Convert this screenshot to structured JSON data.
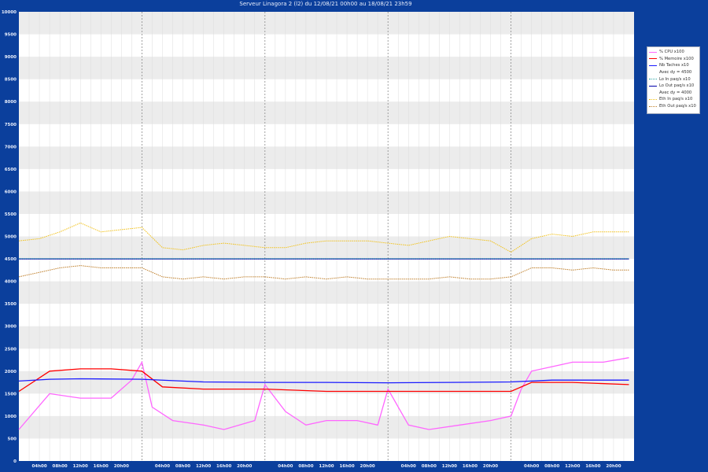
{
  "chart_title": "Serveur Linagora 2 (l2) du 12/08/21 00h00 au 18/08/21 23h59",
  "chart_data": {
    "type": "line",
    "title": "Serveur Linagora 2 (l2) du 12/08/21 00h00 au 18/08/21 23h59",
    "xlabel": "",
    "ylabel": "",
    "ylim": [
      0,
      10000
    ],
    "y_ticks": [
      {
        "value": 0,
        "label": "0"
      },
      {
        "value": 500,
        "label": "500"
      },
      {
        "value": 1000,
        "label": "1000"
      },
      {
        "value": 1500,
        "label": "1500"
      },
      {
        "value": 2000,
        "label": "2000"
      },
      {
        "value": 2500,
        "label": "2500"
      },
      {
        "value": 3000,
        "label": "3000"
      },
      {
        "value": 3500,
        "label": "3500"
      },
      {
        "value": 4000,
        "label": "4000"
      },
      {
        "value": 4500,
        "label": "4500"
      },
      {
        "value": 5000,
        "label": "5000"
      },
      {
        "value": 5500,
        "label": "5500"
      },
      {
        "value": 6000,
        "label": "6000"
      },
      {
        "value": 6500,
        "label": "6500"
      },
      {
        "value": 7000,
        "label": "7000"
      },
      {
        "value": 7500,
        "label": "7500"
      },
      {
        "value": 8000,
        "label": "8000"
      },
      {
        "value": 8500,
        "label": "8500"
      },
      {
        "value": 9000,
        "label": "9000"
      },
      {
        "value": 9500,
        "label": "9500"
      },
      {
        "value": 10000,
        "label": "10000"
      }
    ],
    "x_ticks": [
      {
        "value": 4,
        "label": "04h00"
      },
      {
        "value": 8,
        "label": "08h00"
      },
      {
        "value": 12,
        "label": "12h00"
      },
      {
        "value": 16,
        "label": "16h00"
      },
      {
        "value": 20,
        "label": "20h00"
      },
      {
        "value": 28,
        "label": "04h00"
      },
      {
        "value": 32,
        "label": "08h00"
      },
      {
        "value": 36,
        "label": "12h00"
      },
      {
        "value": 40,
        "label": "16h00"
      },
      {
        "value": 44,
        "label": "20h00"
      },
      {
        "value": 52,
        "label": "04h00"
      },
      {
        "value": 56,
        "label": "08h00"
      },
      {
        "value": 60,
        "label": "12h00"
      },
      {
        "value": 64,
        "label": "16h00"
      },
      {
        "value": 68,
        "label": "20h00"
      },
      {
        "value": 76,
        "label": "04h00"
      },
      {
        "value": 80,
        "label": "08h00"
      },
      {
        "value": 84,
        "label": "12h00"
      },
      {
        "value": 88,
        "label": "16h00"
      },
      {
        "value": 92,
        "label": "20h00"
      },
      {
        "value": 100,
        "label": "04h00"
      },
      {
        "value": 104,
        "label": "08h00"
      },
      {
        "value": 108,
        "label": "12h00"
      },
      {
        "value": 112,
        "label": "16h00"
      },
      {
        "value": 116,
        "label": "20h00"
      }
    ],
    "xlim": [
      0,
      120
    ],
    "grid": true,
    "legend_position": "right",
    "series": [
      {
        "name": "% CPU x100",
        "color": "#ff66ff",
        "style": "solid",
        "x": [
          0,
          6,
          12,
          18,
          22,
          24,
          26,
          30,
          36,
          40,
          46,
          48,
          52,
          56,
          60,
          66,
          70,
          72,
          76,
          80,
          86,
          92,
          96,
          98,
          100,
          104,
          108,
          114,
          119
        ],
        "y": [
          700,
          1500,
          1400,
          1400,
          1800,
          2200,
          1200,
          900,
          800,
          700,
          900,
          1700,
          1100,
          800,
          900,
          900,
          800,
          1600,
          800,
          700,
          800,
          900,
          1000,
          1600,
          2000,
          2100,
          2200,
          2200,
          2300
        ]
      },
      {
        "name": "% Memoire x100",
        "color": "#ff0000",
        "style": "solid",
        "x": [
          0,
          6,
          12,
          18,
          24,
          28,
          36,
          48,
          60,
          72,
          84,
          96,
          100,
          108,
          119
        ],
        "y": [
          1550,
          2000,
          2050,
          2050,
          2000,
          1650,
          1600,
          1600,
          1550,
          1550,
          1550,
          1550,
          1750,
          1750,
          1700
        ]
      },
      {
        "name": "Nb Taches x10",
        "color": "#1a1aff",
        "style": "solid",
        "x": [
          0,
          6,
          12,
          24,
          36,
          48,
          60,
          72,
          84,
          96,
          104,
          119
        ],
        "y": [
          1780,
          1820,
          1830,
          1820,
          1760,
          1750,
          1750,
          1740,
          1750,
          1760,
          1800,
          1800
        ]
      },
      {
        "name": "Avec dy = 4500",
        "color": "#00aa00",
        "style": "none",
        "x": [
          0,
          119
        ],
        "y": [
          4500,
          4500
        ]
      },
      {
        "name": "Lo  In  paq/s x10",
        "color": "#2ea6a6",
        "style": "dot",
        "x": [
          0,
          119
        ],
        "y": [
          4505,
          4505
        ]
      },
      {
        "name": "Lo  Out paq/s x10",
        "color": "#0000aa",
        "style": "solid",
        "x": [
          0,
          119
        ],
        "y": [
          4500,
          4500
        ]
      },
      {
        "name": "Avec dy = 4000",
        "color": "#00aa00",
        "style": "none",
        "x": [
          0,
          119
        ],
        "y": [
          4000,
          4000
        ]
      },
      {
        "name": "Eth  In  paq/s x10",
        "color": "#f2c21b",
        "style": "dot",
        "x": [
          0,
          4,
          8,
          12,
          16,
          20,
          24,
          28,
          32,
          36,
          40,
          44,
          48,
          52,
          56,
          60,
          64,
          68,
          72,
          76,
          80,
          84,
          88,
          92,
          96,
          100,
          104,
          108,
          112,
          116,
          119
        ],
        "y": [
          4900,
          4950,
          5100,
          5300,
          5100,
          5150,
          5200,
          4750,
          4700,
          4800,
          4850,
          4800,
          4750,
          4750,
          4850,
          4900,
          4900,
          4900,
          4850,
          4800,
          4900,
          5000,
          4950,
          4900,
          4650,
          4950,
          5050,
          5000,
          5100,
          5100,
          5100
        ]
      },
      {
        "name": "Eth  Out paq/s x10",
        "color": "#bf7f2a",
        "style": "dot",
        "x": [
          0,
          4,
          8,
          12,
          16,
          20,
          24,
          28,
          32,
          36,
          40,
          44,
          48,
          52,
          56,
          60,
          64,
          68,
          72,
          76,
          80,
          84,
          88,
          92,
          96,
          100,
          104,
          108,
          112,
          116,
          119
        ],
        "y": [
          4100,
          4200,
          4300,
          4350,
          4300,
          4300,
          4300,
          4100,
          4050,
          4100,
          4050,
          4100,
          4100,
          4050,
          4100,
          4050,
          4100,
          4050,
          4050,
          4050,
          4050,
          4100,
          4050,
          4050,
          4100,
          4300,
          4300,
          4250,
          4300,
          4250,
          4250
        ]
      }
    ]
  },
  "colors": {
    "background": "#0b3f9c",
    "plot_bg": "#ffffff",
    "band": "#ececec",
    "axis_text": "#e8eefc"
  }
}
